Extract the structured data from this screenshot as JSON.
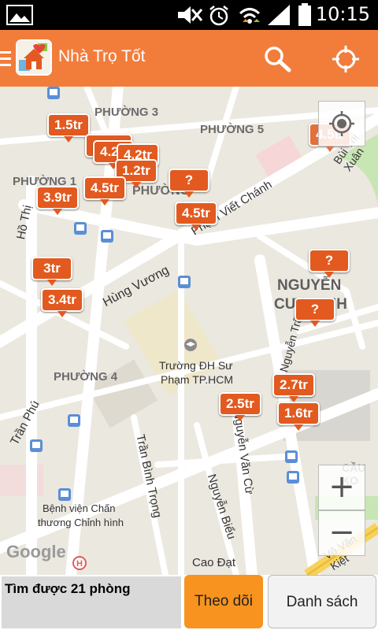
{
  "status": {
    "time": "10:15"
  },
  "app": {
    "title": "Nhà Trọ Tốt"
  },
  "map": {
    "prices": [
      "1.5tr",
      "4.2",
      "4.2tr",
      "1.2tr",
      "4.5tr",
      "3.9tr",
      "?",
      "4.5tr",
      "4.5tr",
      "3tr",
      "3.4tr",
      "?",
      "?",
      "2.7tr",
      "2.5tr",
      "1.6tr"
    ],
    "labels": {
      "phuong3": "PHƯỜNG 3",
      "phuong5": "PHƯỜNG 5",
      "phuong1": "PHƯỜNG 1",
      "phuong2": "PHƯỜNG",
      "phuong4": "PHƯỜNG 4",
      "nguyen1": "NGUYỄN",
      "nguyen2": "CƯ TRINH",
      "cauko": "CẦU KO",
      "ho_thi": "Hồ Thị",
      "hung_vuong": "Hùng Vương",
      "pham_viet_chanh": "Phạm Viết Chánh",
      "bui_thi_xuan": "Bùi Thị Xuân",
      "truong1": "Trường ĐH Sư",
      "truong2": "Phạm TP.HCM",
      "tran_phu": "Trần Phú",
      "tran_binh_trong": "Trần Bình Trọng",
      "nguyen_van_cu": "Nguyễn Văn Cừ",
      "nguyen_bieu": "Nguyễn Biểu",
      "nguyen_trai": "Nguyễn Trãi",
      "benh_vien1": "Bệnh viện Chấn",
      "benh_vien2": "thương Chỉnh hình",
      "cao_dat": "Cao Đạt",
      "vo_van_kiet": "Võ Văn Kiệt",
      "google": "Google"
    },
    "zoom": {
      "plus": "+",
      "minus": "−"
    }
  },
  "bottom": {
    "found": "Tìm được 21 phòng",
    "follow": "Theo dõi",
    "list": "Danh sách"
  },
  "colors": {
    "accent": "#f27d3b",
    "pin": "#e25a1f",
    "follow": "#f7931e"
  }
}
